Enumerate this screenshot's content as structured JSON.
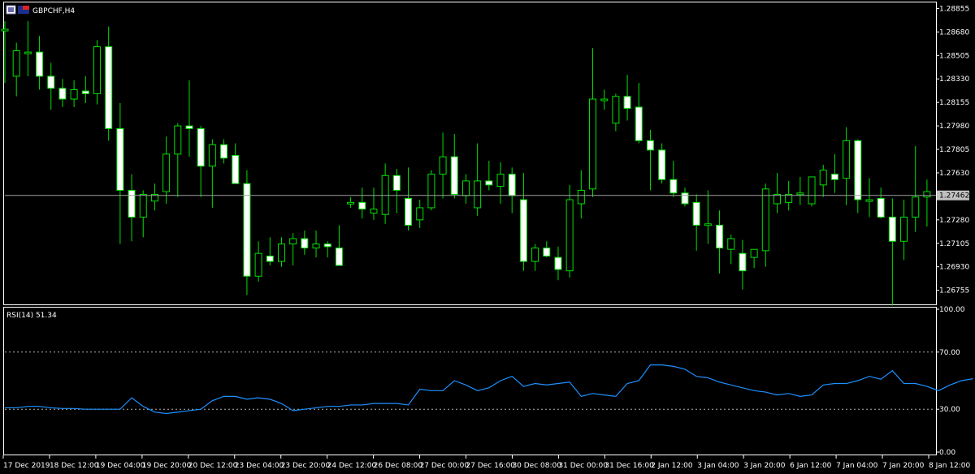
{
  "chart_data": [
    {
      "type": "candlestick",
      "title": "GBPCHF,H4",
      "price_ticks": [
        "1.28855",
        "1.28680",
        "1.28505",
        "1.28330",
        "1.28155",
        "1.27980",
        "1.27805",
        "1.27630",
        "1.27455",
        "1.27280",
        "1.27105",
        "1.26930",
        "1.26755"
      ],
      "ylim": [
        1.2665,
        1.289
      ],
      "current_price": "1.27462",
      "time_labels": [
        "17 Dec 2019",
        "18 Dec 12:00",
        "19 Dec 04:00",
        "19 Dec 20:00",
        "20 Dec 12:00",
        "23 Dec 04:00",
        "23 Dec 20:00",
        "24 Dec 12:00",
        "26 Dec 08:00",
        "27 Dec 00:00",
        "27 Dec 16:00",
        "30 Dec 08:00",
        "31 Dec 00:00",
        "31 Dec 16:00",
        "2 Jan 12:00",
        "3 Jan 04:00",
        "3 Jan 20:00",
        "6 Jan 12:00",
        "7 Jan 04:00",
        "7 Jan 20:00",
        "8 Jan 12:00"
      ],
      "candles": [
        {
          "o": 1.287,
          "h": 1.2876,
          "l": 1.283,
          "c": 1.287
        },
        {
          "o": 1.2835,
          "h": 1.286,
          "l": 1.282,
          "c": 1.2854
        },
        {
          "o": 1.2853,
          "h": 1.2876,
          "l": 1.2835,
          "c": 1.2853
        },
        {
          "o": 1.2853,
          "h": 1.2865,
          "l": 1.2825,
          "c": 1.2835
        },
        {
          "o": 1.2835,
          "h": 1.2845,
          "l": 1.281,
          "c": 1.2826
        },
        {
          "o": 1.2826,
          "h": 1.2833,
          "l": 1.2812,
          "c": 1.2818
        },
        {
          "o": 1.2818,
          "h": 1.2832,
          "l": 1.2812,
          "c": 1.2825
        },
        {
          "o": 1.2824,
          "h": 1.2835,
          "l": 1.2815,
          "c": 1.2822
        },
        {
          "o": 1.2822,
          "h": 1.2862,
          "l": 1.2814,
          "c": 1.2857
        },
        {
          "o": 1.2857,
          "h": 1.2872,
          "l": 1.2787,
          "c": 1.2796
        },
        {
          "o": 1.2796,
          "h": 1.2815,
          "l": 1.271,
          "c": 1.275
        },
        {
          "o": 1.275,
          "h": 1.2762,
          "l": 1.2712,
          "c": 1.273
        },
        {
          "o": 1.273,
          "h": 1.275,
          "l": 1.2715,
          "c": 1.2747
        },
        {
          "o": 1.2742,
          "h": 1.2755,
          "l": 1.2735,
          "c": 1.2747
        },
        {
          "o": 1.2749,
          "h": 1.279,
          "l": 1.274,
          "c": 1.2777
        },
        {
          "o": 1.2777,
          "h": 1.28,
          "l": 1.2745,
          "c": 1.2798
        },
        {
          "o": 1.2798,
          "h": 1.2832,
          "l": 1.2775,
          "c": 1.2796
        },
        {
          "o": 1.2796,
          "h": 1.2798,
          "l": 1.2745,
          "c": 1.2768
        },
        {
          "o": 1.2768,
          "h": 1.2788,
          "l": 1.2737,
          "c": 1.2784
        },
        {
          "o": 1.2784,
          "h": 1.2788,
          "l": 1.277,
          "c": 1.2774
        },
        {
          "o": 1.2776,
          "h": 1.2785,
          "l": 1.2755,
          "c": 1.2755
        },
        {
          "o": 1.2755,
          "h": 1.2765,
          "l": 1.2672,
          "c": 1.2686
        },
        {
          "o": 1.2686,
          "h": 1.2712,
          "l": 1.2682,
          "c": 1.2703
        },
        {
          "o": 1.2701,
          "h": 1.2715,
          "l": 1.2694,
          "c": 1.2697
        },
        {
          "o": 1.2697,
          "h": 1.2715,
          "l": 1.2693,
          "c": 1.271
        },
        {
          "o": 1.271,
          "h": 1.2718,
          "l": 1.2694,
          "c": 1.2714
        },
        {
          "o": 1.2714,
          "h": 1.272,
          "l": 1.2702,
          "c": 1.2707
        },
        {
          "o": 1.2707,
          "h": 1.272,
          "l": 1.27,
          "c": 1.271
        },
        {
          "o": 1.271,
          "h": 1.2712,
          "l": 1.27,
          "c": 1.2708
        },
        {
          "o": 1.2707,
          "h": 1.2724,
          "l": 1.2695,
          "c": 1.2694
        },
        {
          "o": 1.2741,
          "h": 1.2745,
          "l": 1.2737,
          "c": 1.2741
        },
        {
          "o": 1.2741,
          "h": 1.2752,
          "l": 1.2729,
          "c": 1.2736
        },
        {
          "o": 1.2733,
          "h": 1.2752,
          "l": 1.2728,
          "c": 1.2736
        },
        {
          "o": 1.2732,
          "h": 1.277,
          "l": 1.2725,
          "c": 1.2761
        },
        {
          "o": 1.2761,
          "h": 1.2766,
          "l": 1.2733,
          "c": 1.275
        },
        {
          "o": 1.2744,
          "h": 1.2767,
          "l": 1.272,
          "c": 1.2724
        },
        {
          "o": 1.2728,
          "h": 1.2743,
          "l": 1.2722,
          "c": 1.2737
        },
        {
          "o": 1.2737,
          "h": 1.2765,
          "l": 1.2735,
          "c": 1.2762
        },
        {
          "o": 1.2762,
          "h": 1.2793,
          "l": 1.2744,
          "c": 1.2775
        },
        {
          "o": 1.2775,
          "h": 1.2792,
          "l": 1.2744,
          "c": 1.2747
        },
        {
          "o": 1.2746,
          "h": 1.2762,
          "l": 1.274,
          "c": 1.2757
        },
        {
          "o": 1.2737,
          "h": 1.2785,
          "l": 1.2731,
          "c": 1.2757
        },
        {
          "o": 1.2757,
          "h": 1.2772,
          "l": 1.275,
          "c": 1.2754
        },
        {
          "o": 1.2753,
          "h": 1.2771,
          "l": 1.274,
          "c": 1.2762
        },
        {
          "o": 1.2762,
          "h": 1.2767,
          "l": 1.2733,
          "c": 1.2746
        },
        {
          "o": 1.2743,
          "h": 1.2763,
          "l": 1.269,
          "c": 1.2697
        },
        {
          "o": 1.2697,
          "h": 1.271,
          "l": 1.269,
          "c": 1.2707
        },
        {
          "o": 1.2707,
          "h": 1.2712,
          "l": 1.27,
          "c": 1.2701
        },
        {
          "o": 1.27,
          "h": 1.2708,
          "l": 1.2683,
          "c": 1.2691
        },
        {
          "o": 1.269,
          "h": 1.2754,
          "l": 1.2685,
          "c": 1.2743
        },
        {
          "o": 1.274,
          "h": 1.2765,
          "l": 1.2729,
          "c": 1.275
        },
        {
          "o": 1.2751,
          "h": 1.2856,
          "l": 1.2745,
          "c": 1.2818
        },
        {
          "o": 1.2818,
          "h": 1.2825,
          "l": 1.281,
          "c": 1.2818
        },
        {
          "o": 1.28,
          "h": 1.2822,
          "l": 1.2794,
          "c": 1.282
        },
        {
          "o": 1.282,
          "h": 1.2836,
          "l": 1.2802,
          "c": 1.2811
        },
        {
          "o": 1.2812,
          "h": 1.283,
          "l": 1.2785,
          "c": 1.2787
        },
        {
          "o": 1.2787,
          "h": 1.2795,
          "l": 1.275,
          "c": 1.278
        },
        {
          "o": 1.278,
          "h": 1.2785,
          "l": 1.2755,
          "c": 1.2758
        },
        {
          "o": 1.2758,
          "h": 1.2772,
          "l": 1.2745,
          "c": 1.2748
        },
        {
          "o": 1.2748,
          "h": 1.2752,
          "l": 1.2738,
          "c": 1.274
        },
        {
          "o": 1.2741,
          "h": 1.2747,
          "l": 1.2705,
          "c": 1.2724
        },
        {
          "o": 1.2725,
          "h": 1.275,
          "l": 1.271,
          "c": 1.2725
        },
        {
          "o": 1.2724,
          "h": 1.2735,
          "l": 1.2688,
          "c": 1.2707
        },
        {
          "o": 1.2706,
          "h": 1.2717,
          "l": 1.2695,
          "c": 1.2714
        },
        {
          "o": 1.2703,
          "h": 1.2713,
          "l": 1.2676,
          "c": 1.269
        },
        {
          "o": 1.27,
          "h": 1.2706,
          "l": 1.2692,
          "c": 1.2706
        },
        {
          "o": 1.2705,
          "h": 1.2755,
          "l": 1.2693,
          "c": 1.2751
        },
        {
          "o": 1.274,
          "h": 1.2763,
          "l": 1.2733,
          "c": 1.2747
        },
        {
          "o": 1.2741,
          "h": 1.2757,
          "l": 1.2735,
          "c": 1.2747
        },
        {
          "o": 1.2747,
          "h": 1.276,
          "l": 1.2739,
          "c": 1.2748
        },
        {
          "o": 1.274,
          "h": 1.276,
          "l": 1.2738,
          "c": 1.276
        },
        {
          "o": 1.2754,
          "h": 1.2769,
          "l": 1.2745,
          "c": 1.2765
        },
        {
          "o": 1.2762,
          "h": 1.2777,
          "l": 1.2748,
          "c": 1.2758
        },
        {
          "o": 1.2759,
          "h": 1.2797,
          "l": 1.2739,
          "c": 1.2787
        },
        {
          "o": 1.2787,
          "h": 1.2788,
          "l": 1.2733,
          "c": 1.2743
        },
        {
          "o": 1.2743,
          "h": 1.2759,
          "l": 1.273,
          "c": 1.2743
        },
        {
          "o": 1.2744,
          "h": 1.2752,
          "l": 1.2729,
          "c": 1.273
        },
        {
          "o": 1.273,
          "h": 1.2744,
          "l": 1.2664,
          "c": 1.2712
        },
        {
          "o": 1.2712,
          "h": 1.2743,
          "l": 1.2698,
          "c": 1.273
        },
        {
          "o": 1.273,
          "h": 1.2783,
          "l": 1.2719,
          "c": 1.2745
        },
        {
          "o": 1.2745,
          "h": 1.2758,
          "l": 1.2723,
          "c": 1.2749
        }
      ]
    },
    {
      "type": "line",
      "title": "RSI(14) 51.34",
      "ylim": [
        0,
        100
      ],
      "y_ticks": [
        "100.00",
        "70.00",
        "30.00",
        "0.00"
      ],
      "levels": [
        70,
        30
      ],
      "values": [
        31,
        31,
        32,
        32,
        31,
        30.5,
        30.5,
        30,
        30,
        30,
        30,
        38,
        32,
        28,
        27,
        28,
        29,
        30,
        36,
        39,
        39,
        37,
        38,
        37,
        34,
        29,
        30,
        31,
        32,
        32,
        33,
        33,
        34,
        34,
        34,
        33,
        44,
        43,
        43,
        50,
        47,
        43,
        45,
        50,
        53,
        46,
        48,
        47,
        48,
        49,
        39,
        41,
        40,
        39,
        48,
        50,
        61,
        61,
        60,
        58,
        53,
        52,
        49,
        47,
        45,
        43,
        42,
        40,
        41,
        39,
        40,
        47,
        48,
        48,
        50,
        53,
        51,
        57,
        48,
        48,
        46,
        43,
        47,
        50,
        51.34
      ],
      "color": "#1e90ff"
    }
  ]
}
